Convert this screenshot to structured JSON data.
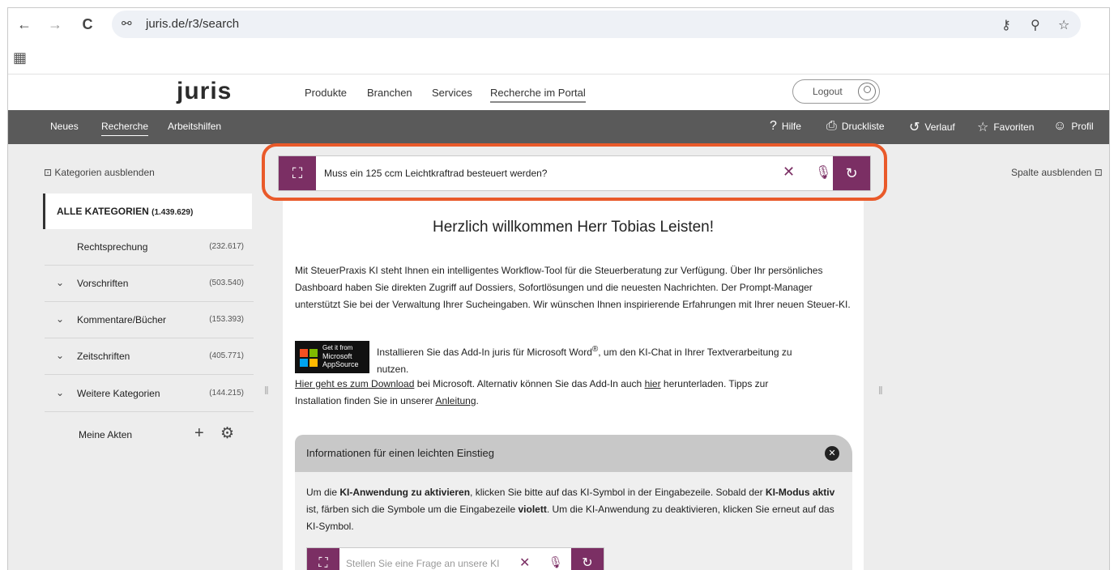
{
  "browser": {
    "url": "juris.de/r3/search",
    "back_icon": "←",
    "forward_icon": "→",
    "reload_icon": "C",
    "site_info_icon": "⚯",
    "key_icon": "⚷",
    "zoom_icon": "⚲",
    "star_icon": "☆",
    "apps_icon": "▦"
  },
  "header": {
    "logo": "juris",
    "nav": [
      "Produkte",
      "Branchen",
      "Services",
      "Recherche im Portal"
    ],
    "logout_label": "Logout"
  },
  "toolbar": {
    "left": [
      "Neues",
      "Recherche",
      "Arbeitshilfen"
    ],
    "right": [
      {
        "icon": "?",
        "label": "Hilfe"
      },
      {
        "icon": "⎙",
        "label": "Druckliste"
      },
      {
        "icon": "↺",
        "label": "Verlauf"
      },
      {
        "icon": "☆",
        "label": "Favoriten"
      },
      {
        "icon": "☺",
        "label": "Profil"
      }
    ]
  },
  "sidebar": {
    "hide_label": "Kategorien ausblenden",
    "all_label": "ALLE KATEGORIEN",
    "all_count": "(1.439.629)",
    "items": [
      {
        "label": "Rechtsprechung",
        "count": "(232.617)",
        "chevron": ""
      },
      {
        "label": "Vorschriften",
        "count": "(503.540)",
        "chevron": "⌄"
      },
      {
        "label": "Kommentare/Bücher",
        "count": "(153.393)",
        "chevron": "⌄"
      },
      {
        "label": "Zeitschriften",
        "count": "(405.771)",
        "chevron": "⌄"
      },
      {
        "label": "Weitere Kategorien",
        "count": "(144.215)",
        "chevron": "⌄"
      }
    ],
    "akten_label": "Meine Akten",
    "plus_icon": "+",
    "gear_icon": "⚙"
  },
  "right_column": {
    "hide_label": "Spalte ausblenden"
  },
  "search": {
    "query": "Muss ein 125 ccm Leichtkraftrad besteuert werden?",
    "ai_icon": "⛶",
    "clear_icon": "✕",
    "mic_icon": "🎙",
    "go_icon": "↻"
  },
  "main": {
    "welcome": "Herzlich willkommen Herr Tobias Leisten!",
    "intro": "Mit SteuerPraxis KI steht Ihnen ein intelligentes Workflow-Tool für die Steuerberatung zur Verfügung. Über Ihr persönliches Dashboard haben Sie direkten Zugriff auf Dossiers, Sofortlösungen und die neuesten Nachrichten. Der Prompt-Manager unterstützt Sie bei der Verwaltung Ihrer Sucheingaben. Wir wünschen Ihnen inspirierende Erfahrungen mit Ihrer neuen Steuer-KI.",
    "ms_badge_small": "Get it from",
    "ms_badge_line1": "Microsoft",
    "ms_badge_line2": "AppSource",
    "addin_text_a": "Installieren Sie das Add-In juris für Microsoft Word",
    "addin_reg": "®",
    "addin_text_b": ", um den KI-Chat in Ihrer Textverarbeitung zu",
    "addin_text_c": "nutzen.",
    "download_link": "Hier geht es zum Download",
    "download_text_a": " bei Microsoft. Alternativ können Sie das Add-In auch ",
    "here_link": "hier",
    "download_text_b": " herunterladen. Tipps zur",
    "download_text_c": "Installation finden Sie in unserer ",
    "guide_link": "Anleitung",
    "download_text_d": "."
  },
  "info": {
    "title": "Informationen für einen leichten Einstieg",
    "close_icon": "✕",
    "t1": "Um die ",
    "b1": "KI-Anwendung zu aktivieren",
    "t2": ", klicken Sie bitte auf das KI-Symbol in der Eingabezeile. Sobald der ",
    "b2": "KI-Modus aktiv",
    "t3": " ist, färben sich die Symbole um die Eingabezeile ",
    "b3": "violett",
    "t4": ". Um die KI-Anwendung zu deaktivieren, klicken Sie erneut auf das KI-Symbol.",
    "mini_placeholder": "Stellen Sie eine Frage an unsere KI"
  },
  "colors": {
    "accent": "#7b2f64",
    "highlight": "#e95a2a",
    "toolbar": "#5a5a5a"
  }
}
